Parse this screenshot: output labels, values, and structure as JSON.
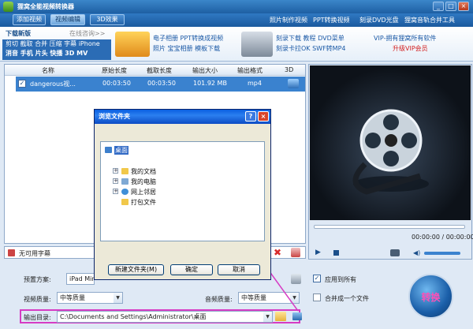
{
  "window": {
    "title": "狸窝全能视频转换器",
    "min": "_",
    "max": "□",
    "close": "×"
  },
  "toolbar": {
    "buttons": [
      "添加视频",
      "视频编辑",
      "3D效果"
    ],
    "links": [
      "照片制作视频",
      "PPT转换视频",
      "刻录DVD光盘",
      "狸窝音轨合并工具"
    ]
  },
  "promo": {
    "download": "下载新版",
    "online": "在线咨询>>",
    "features_line1": "剪切 截取 合并 压缩 字幕 iPhone",
    "features_line2": "消音 手机 片头 快播 3D MV",
    "links_a1": "电子相册 PPT转换成视频",
    "links_a2": "照片 宝宝相册 模板下载",
    "links_b1": "刻录下载 教程 DVD菜单",
    "links_b2": "刻录卡拉OK SWF转MP4",
    "vip1": "VIP-拥有狸窝所有软件",
    "vip2": "升级VIP会员"
  },
  "file_list": {
    "columns": [
      "名称",
      "原始长度",
      "截取长度",
      "输出大小",
      "输出格式",
      "3D"
    ],
    "rows": [
      {
        "name": "dangerous视...",
        "original": "00:03:50",
        "cut": "00:03:50",
        "size": "101.92 MB",
        "format": "mp4"
      }
    ],
    "checked": "✓"
  },
  "subtitle": {
    "text": "无可用字幕"
  },
  "preview": {
    "time": "00:00:00 / 00:00:00"
  },
  "dialog": {
    "title": "浏览文件夹",
    "help": "?",
    "close": "×",
    "tree": [
      {
        "label": "桌面",
        "level": 0,
        "selected": true
      },
      {
        "label": "我的文档",
        "level": 1
      },
      {
        "label": "我的电脑",
        "level": 1
      },
      {
        "label": "网上邻居",
        "level": 1
      },
      {
        "label": "打包文件",
        "level": 1
      }
    ],
    "new_folder": "新建文件夹(M)",
    "ok": "确定",
    "cancel": "取消"
  },
  "settings": {
    "preset_label": "预置方案:",
    "preset_value": "iPad Mini",
    "apply_all": "应用到所有",
    "video_quality_label": "视频质量:",
    "video_quality_value": "中等质量",
    "audio_quality_label": "音频质量:",
    "audio_quality_value": "中等质量",
    "merge_label": "合并成一个文件",
    "output_label": "输出目录:",
    "output_value": "C:\\Documents and Settings\\Administrator\\桌面"
  },
  "convert_button": "转换",
  "colors": {
    "accent": "#2b6cb5",
    "selection": "#3a82cf",
    "annotation": "#d63cc4"
  }
}
